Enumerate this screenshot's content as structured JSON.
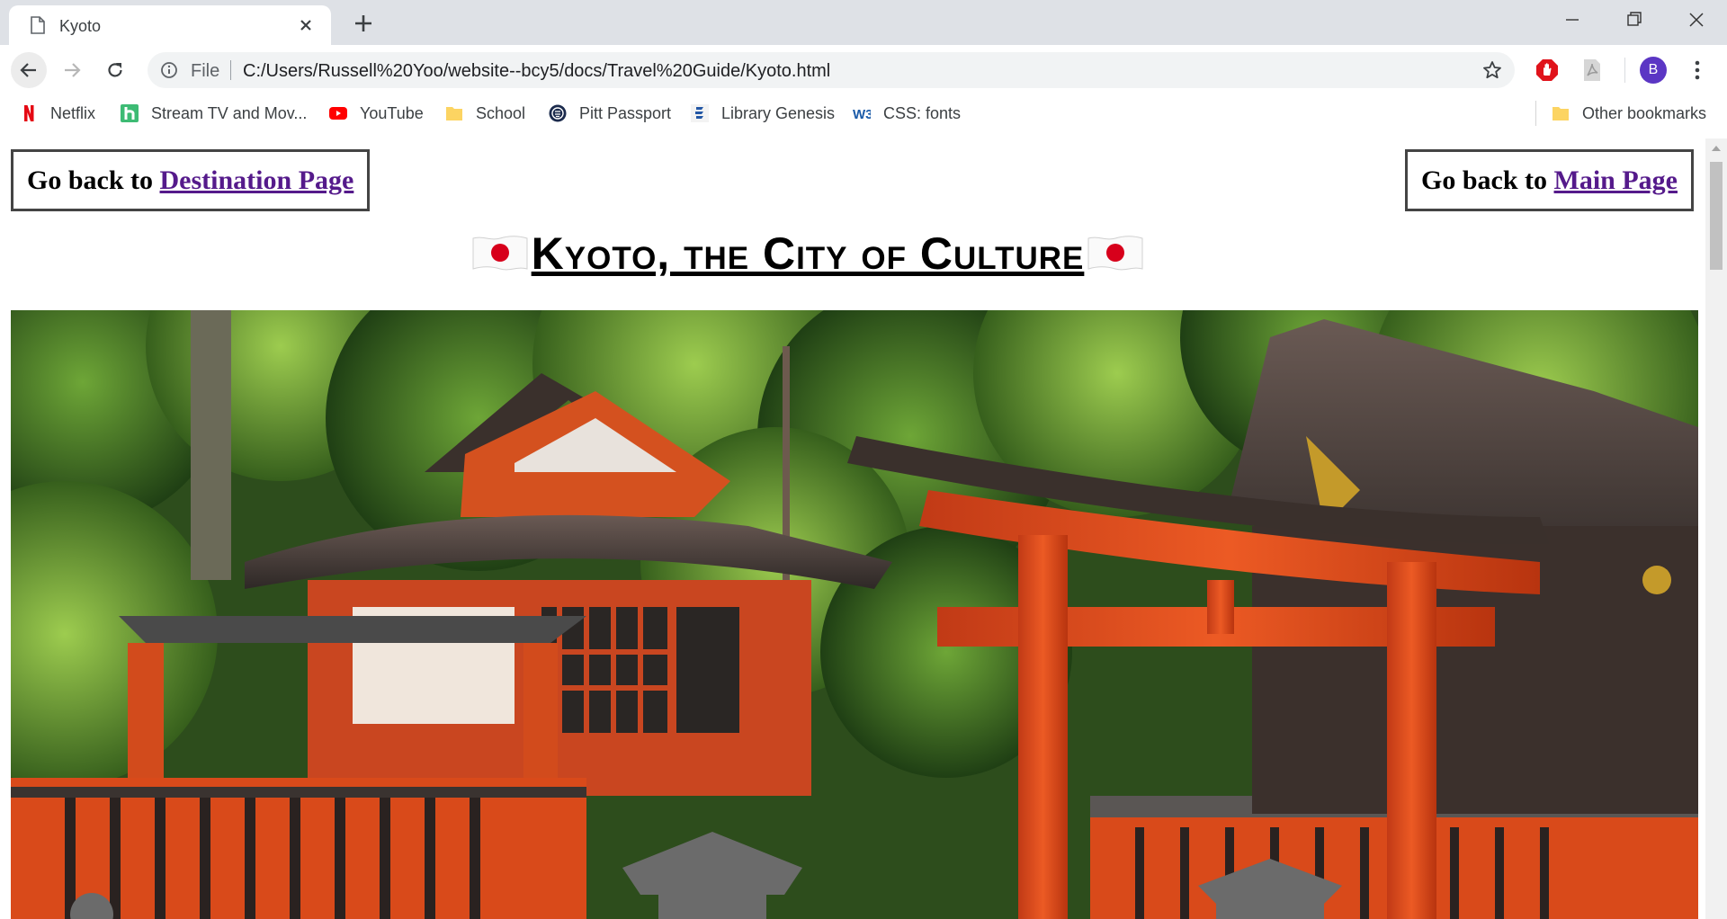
{
  "browser": {
    "tab_title": "Kyoto",
    "address": {
      "scheme_label": "File",
      "url": "C:/Users/Russell%20Yoo/website--bcy5/docs/Travel%20Guide/Kyoto.html"
    },
    "profile_initial": "B",
    "bookmarks": [
      {
        "label": "Netflix",
        "icon": "netflix-icon"
      },
      {
        "label": "Stream TV and Mov...",
        "icon": "hulu-icon"
      },
      {
        "label": "YouTube",
        "icon": "youtube-icon"
      },
      {
        "label": "School",
        "icon": "folder-icon"
      },
      {
        "label": "Pitt Passport",
        "icon": "pitt-icon"
      },
      {
        "label": "Library Genesis",
        "icon": "libgen-icon"
      },
      {
        "label": "CSS: fonts",
        "icon": "w3-icon"
      }
    ],
    "other_bookmarks": "Other bookmarks"
  },
  "page": {
    "back_destination": {
      "prefix": "Go back to ",
      "link": "Destination Page"
    },
    "back_main": {
      "prefix": "Go back to ",
      "link": "Main Page"
    },
    "title": "Kyoto, the City of Culture",
    "flag_icon": "japan-flag-icon",
    "hero_image": "kyoto-shrine-torii-photo"
  },
  "colors": {
    "tabstrip": "#dee1e6",
    "link": "#551a8b",
    "torii": "#e0461e"
  }
}
